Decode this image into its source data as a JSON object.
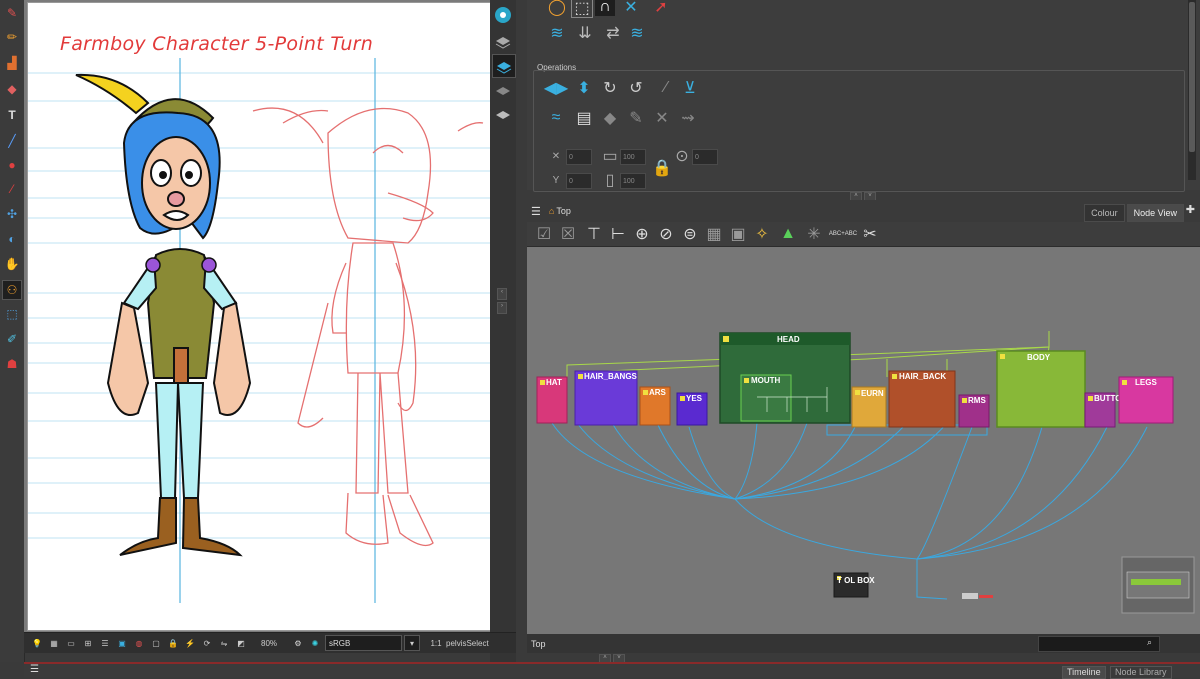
{
  "drawing": {
    "title": "Farmboy Character 5-Point Turn"
  },
  "camera_toolbar": {
    "zoom": "80%",
    "color_space": "sRGB",
    "ratio": "1:1",
    "selection": "pelvisSelect"
  },
  "properties": {
    "operations_label": "Operations",
    "fields": {
      "x": "0",
      "y": "0",
      "width": "100",
      "height": "100",
      "angle": "0"
    }
  },
  "node_view": {
    "breadcrumb": "Top",
    "tabs": [
      "Colour",
      "Node View"
    ],
    "toolbar_text": "ABC+ABC",
    "footer_path": "Top",
    "nodes": {
      "head": "HEAD",
      "hat": "HAT",
      "hair_bangs": "HAIR_BANGS",
      "ears": "ARS",
      "eyes": "YES",
      "mouth": "MOUTH",
      "eyebrows": "EURN",
      "hair_back": "HAIR_BACK",
      "arms": "RMS",
      "body": "BODY",
      "buttons": "BUTTO",
      "legs": "LEGS",
      "tool_box": "T OL BOX"
    }
  },
  "bottom_dock": {
    "tabs": [
      "Timeline",
      "Node Library"
    ]
  },
  "colors": {
    "panel_bg": "#3b3b3b",
    "node_canvas": "#777777",
    "title_red": "#e23a3a",
    "cable_blue": "#3aa8e0",
    "cable_green": "#a8d84a"
  }
}
